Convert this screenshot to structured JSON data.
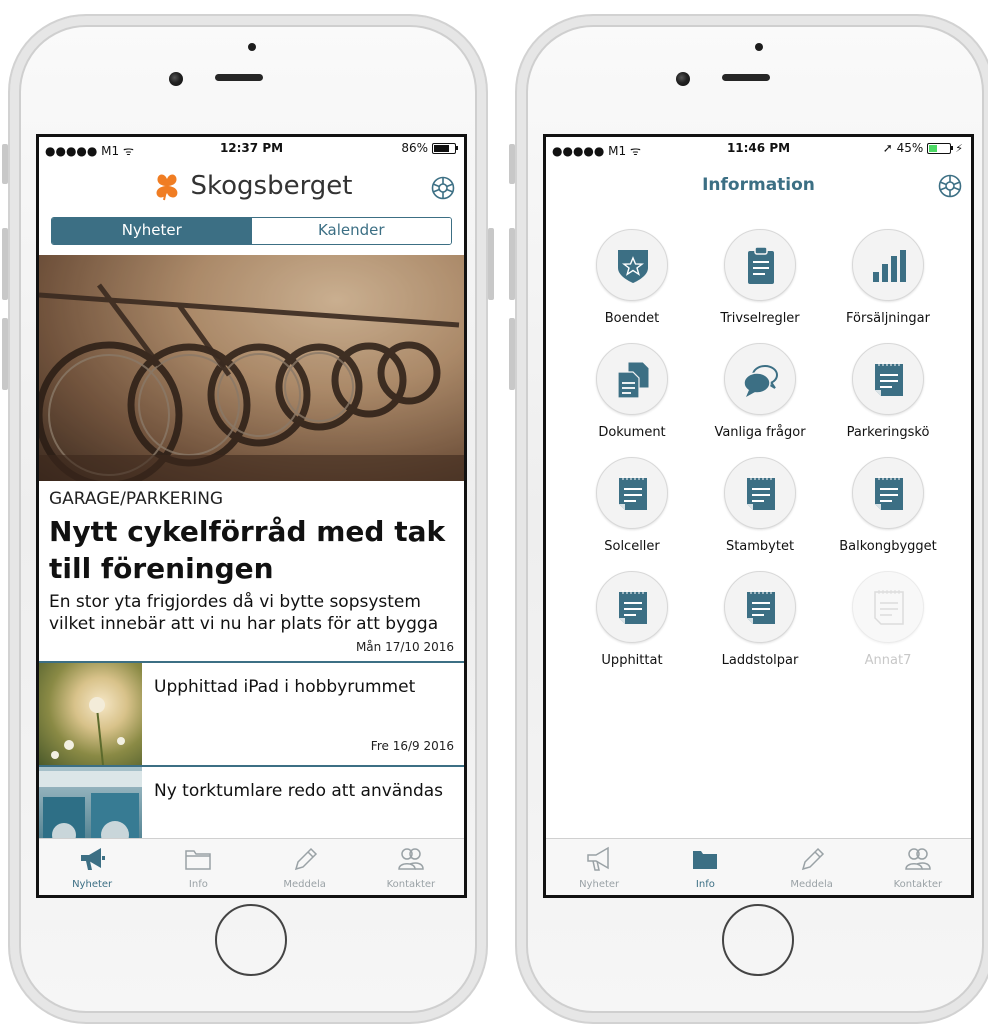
{
  "left_phone": {
    "status_bar": {
      "carrier": "●●●●● M1 ᯤ",
      "time": "12:37 PM",
      "battery": "86%",
      "battery_level": 0.86
    },
    "brand": {
      "name": "Skogsberget",
      "logo_icon": "clover-logo-icon",
      "logo_color": "#f07d23"
    },
    "settings_icon": "settings-gear-icon",
    "segments": [
      {
        "label": "Nyheter",
        "active": true
      },
      {
        "label": "Kalender",
        "active": false
      }
    ],
    "featured_article": {
      "image": "bicycle-rack-photo",
      "category": "GARAGE/PARKERING",
      "headline": "Nytt cykelförråd med tak till föreningen",
      "summary": "En stor yta frigjordes då vi bytte sopsystem vilket innebär att vi nu har plats för att bygga",
      "date": "Mån 17/10 2016"
    },
    "news_list": [
      {
        "title": "Upphittad iPad i hobbyrummet",
        "date": "Fre 16/9 2016",
        "image": "flower-photo"
      },
      {
        "title": "Ny torktumlare redo att användas",
        "date": "",
        "image": "laundry-room-photo"
      }
    ],
    "tabs": [
      {
        "label": "Nyheter",
        "icon": "megaphone-icon",
        "active": true
      },
      {
        "label": "Info",
        "icon": "folder-icon",
        "active": false
      },
      {
        "label": "Meddela",
        "icon": "pencil-icon",
        "active": false
      },
      {
        "label": "Kontakter",
        "icon": "contacts-icon",
        "active": false
      }
    ]
  },
  "right_phone": {
    "status_bar": {
      "carrier": "●●●●● M1 ᯤ",
      "time": "11:46 PM",
      "battery": "➚ 45%",
      "battery_level": 0.45
    },
    "title": "Information",
    "settings_icon": "settings-gear-icon",
    "grid": [
      {
        "label": "Boendet",
        "icon": "shield-star-icon",
        "enabled": true
      },
      {
        "label": "Trivselregler",
        "icon": "clipboard-icon",
        "enabled": true
      },
      {
        "label": "Försäljningar",
        "icon": "bar-chart-icon",
        "enabled": true
      },
      {
        "label": "Dokument",
        "icon": "documents-icon",
        "enabled": true
      },
      {
        "label": "Vanliga frågor",
        "icon": "speech-bubbles-icon",
        "enabled": true
      },
      {
        "label": "Parkeringskö",
        "icon": "notepad-icon",
        "enabled": true
      },
      {
        "label": "Solceller",
        "icon": "notepad-icon",
        "enabled": true
      },
      {
        "label": "Stambytet",
        "icon": "notepad-icon",
        "enabled": true
      },
      {
        "label": "Balkongbygget",
        "icon": "notepad-icon",
        "enabled": true
      },
      {
        "label": "Upphittat",
        "icon": "notepad-icon",
        "enabled": true
      },
      {
        "label": "Laddstolpar",
        "icon": "notepad-icon",
        "enabled": true
      },
      {
        "label": "Annat7",
        "icon": "notepad-icon",
        "enabled": false
      }
    ],
    "tabs": [
      {
        "label": "Nyheter",
        "icon": "megaphone-icon",
        "active": false
      },
      {
        "label": "Info",
        "icon": "folder-icon",
        "active": true
      },
      {
        "label": "Meddela",
        "icon": "pencil-icon",
        "active": false
      },
      {
        "label": "Kontakter",
        "icon": "contacts-icon",
        "active": false
      }
    ]
  },
  "colors": {
    "accent": "#3c6f84",
    "brand": "#f07d23",
    "inactive_tab": "#9aa2a6",
    "disabled": "#c8c8c8"
  }
}
